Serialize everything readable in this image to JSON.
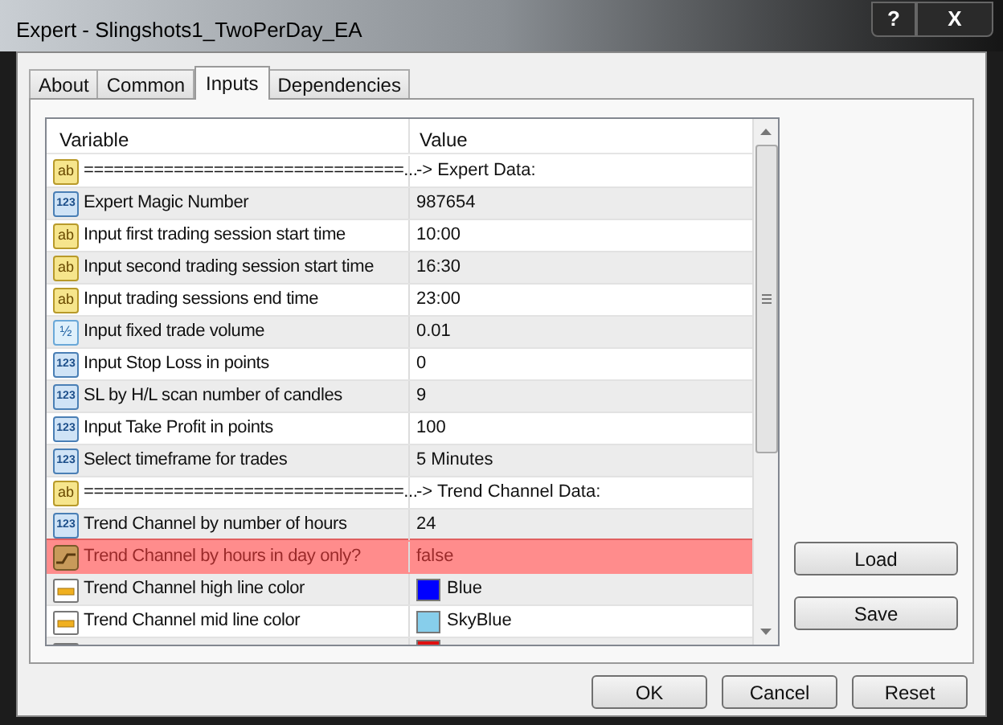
{
  "window": {
    "title": "Expert - Slingshots1_TwoPerDay_EA",
    "help_button": "?",
    "close_button": "X"
  },
  "tabs": [
    {
      "label": "About",
      "selected": false
    },
    {
      "label": "Common",
      "selected": false
    },
    {
      "label": "Inputs",
      "selected": true
    },
    {
      "label": "Dependencies",
      "selected": false
    }
  ],
  "table": {
    "columns": [
      "Variable",
      "Value"
    ],
    "rows": [
      {
        "kind": "string",
        "badge": "ab",
        "variable": "================================...",
        "value": "-> Expert Data:",
        "highlighted": false
      },
      {
        "kind": "int",
        "badge": "123",
        "variable": "Expert Magic Number",
        "value": "987654",
        "highlighted": false
      },
      {
        "kind": "string",
        "badge": "ab",
        "variable": "Input first trading session start time",
        "value": "10:00",
        "highlighted": false
      },
      {
        "kind": "string",
        "badge": "ab",
        "variable": "Input second trading session start time",
        "value": "16:30",
        "highlighted": false
      },
      {
        "kind": "string",
        "badge": "ab",
        "variable": "Input trading sessions end time",
        "value": "23:00",
        "highlighted": false
      },
      {
        "kind": "double",
        "badge": "½",
        "variable": "Input fixed trade volume",
        "value": "0.01",
        "highlighted": false
      },
      {
        "kind": "int",
        "badge": "123",
        "variable": "Input Stop Loss in points",
        "value": "0",
        "highlighted": false
      },
      {
        "kind": "int",
        "badge": "123",
        "variable": "SL by H/L scan number of candles",
        "value": "9",
        "highlighted": false
      },
      {
        "kind": "int",
        "badge": "123",
        "variable": "Input Take Profit in points",
        "value": "100",
        "highlighted": false
      },
      {
        "kind": "int",
        "badge": "123",
        "variable": "Select timeframe for trades",
        "value": "5 Minutes",
        "highlighted": false
      },
      {
        "kind": "string",
        "badge": "ab",
        "variable": "================================...",
        "value": "-> Trend Channel Data:",
        "highlighted": false
      },
      {
        "kind": "int",
        "badge": "123",
        "variable": "Trend Channel by number of hours",
        "value": "24",
        "highlighted": false
      },
      {
        "kind": "bool",
        "variable": "Trend Channel by hours in day only?",
        "value": "false",
        "highlighted": true
      },
      {
        "kind": "color",
        "variable": "Trend Channel high line color",
        "value": "Blue",
        "color": "#0000ff",
        "highlighted": false
      },
      {
        "kind": "color",
        "variable": "Trend Channel mid line color",
        "value": "SkyBlue",
        "color": "#87ceeb",
        "highlighted": false
      },
      {
        "kind": "color",
        "color": "#e01010",
        "highlighted": false
      }
    ]
  },
  "side_buttons": [
    "Load",
    "Save"
  ],
  "buttons": [
    "OK",
    "Cancel",
    "Reset"
  ]
}
